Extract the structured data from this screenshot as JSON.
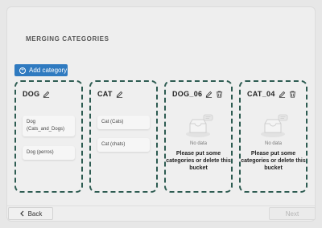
{
  "page": {
    "title": "MERGING CATEGORIES"
  },
  "toolbar": {
    "add_label": "Add category"
  },
  "buckets": [
    {
      "name": "DOG",
      "items": [
        "Dog (Cats_and_Dogs)",
        "Dog (perros)"
      ]
    },
    {
      "name": "CAT",
      "items": [
        "Cat (Cats)",
        "Cat (chats)"
      ]
    },
    {
      "name": "DOG_06",
      "no_data": "No data",
      "empty_message": "Please put some categories or delete this bucket"
    },
    {
      "name": "CAT_04",
      "no_data": "No data",
      "empty_message": "Please put some categories or delete this bucket"
    }
  ],
  "footer": {
    "back_label": "Back",
    "next_label": "Next"
  },
  "colors": {
    "accent": "#2f7ac0",
    "bucket_border": "#2e5c52",
    "background": "#eeeeee"
  },
  "icons": {
    "edit": "pencil-icon",
    "delete": "trash-icon",
    "add": "plus-circle-icon",
    "back": "chevron-left-icon",
    "empty": "empty-inbox-icon"
  }
}
